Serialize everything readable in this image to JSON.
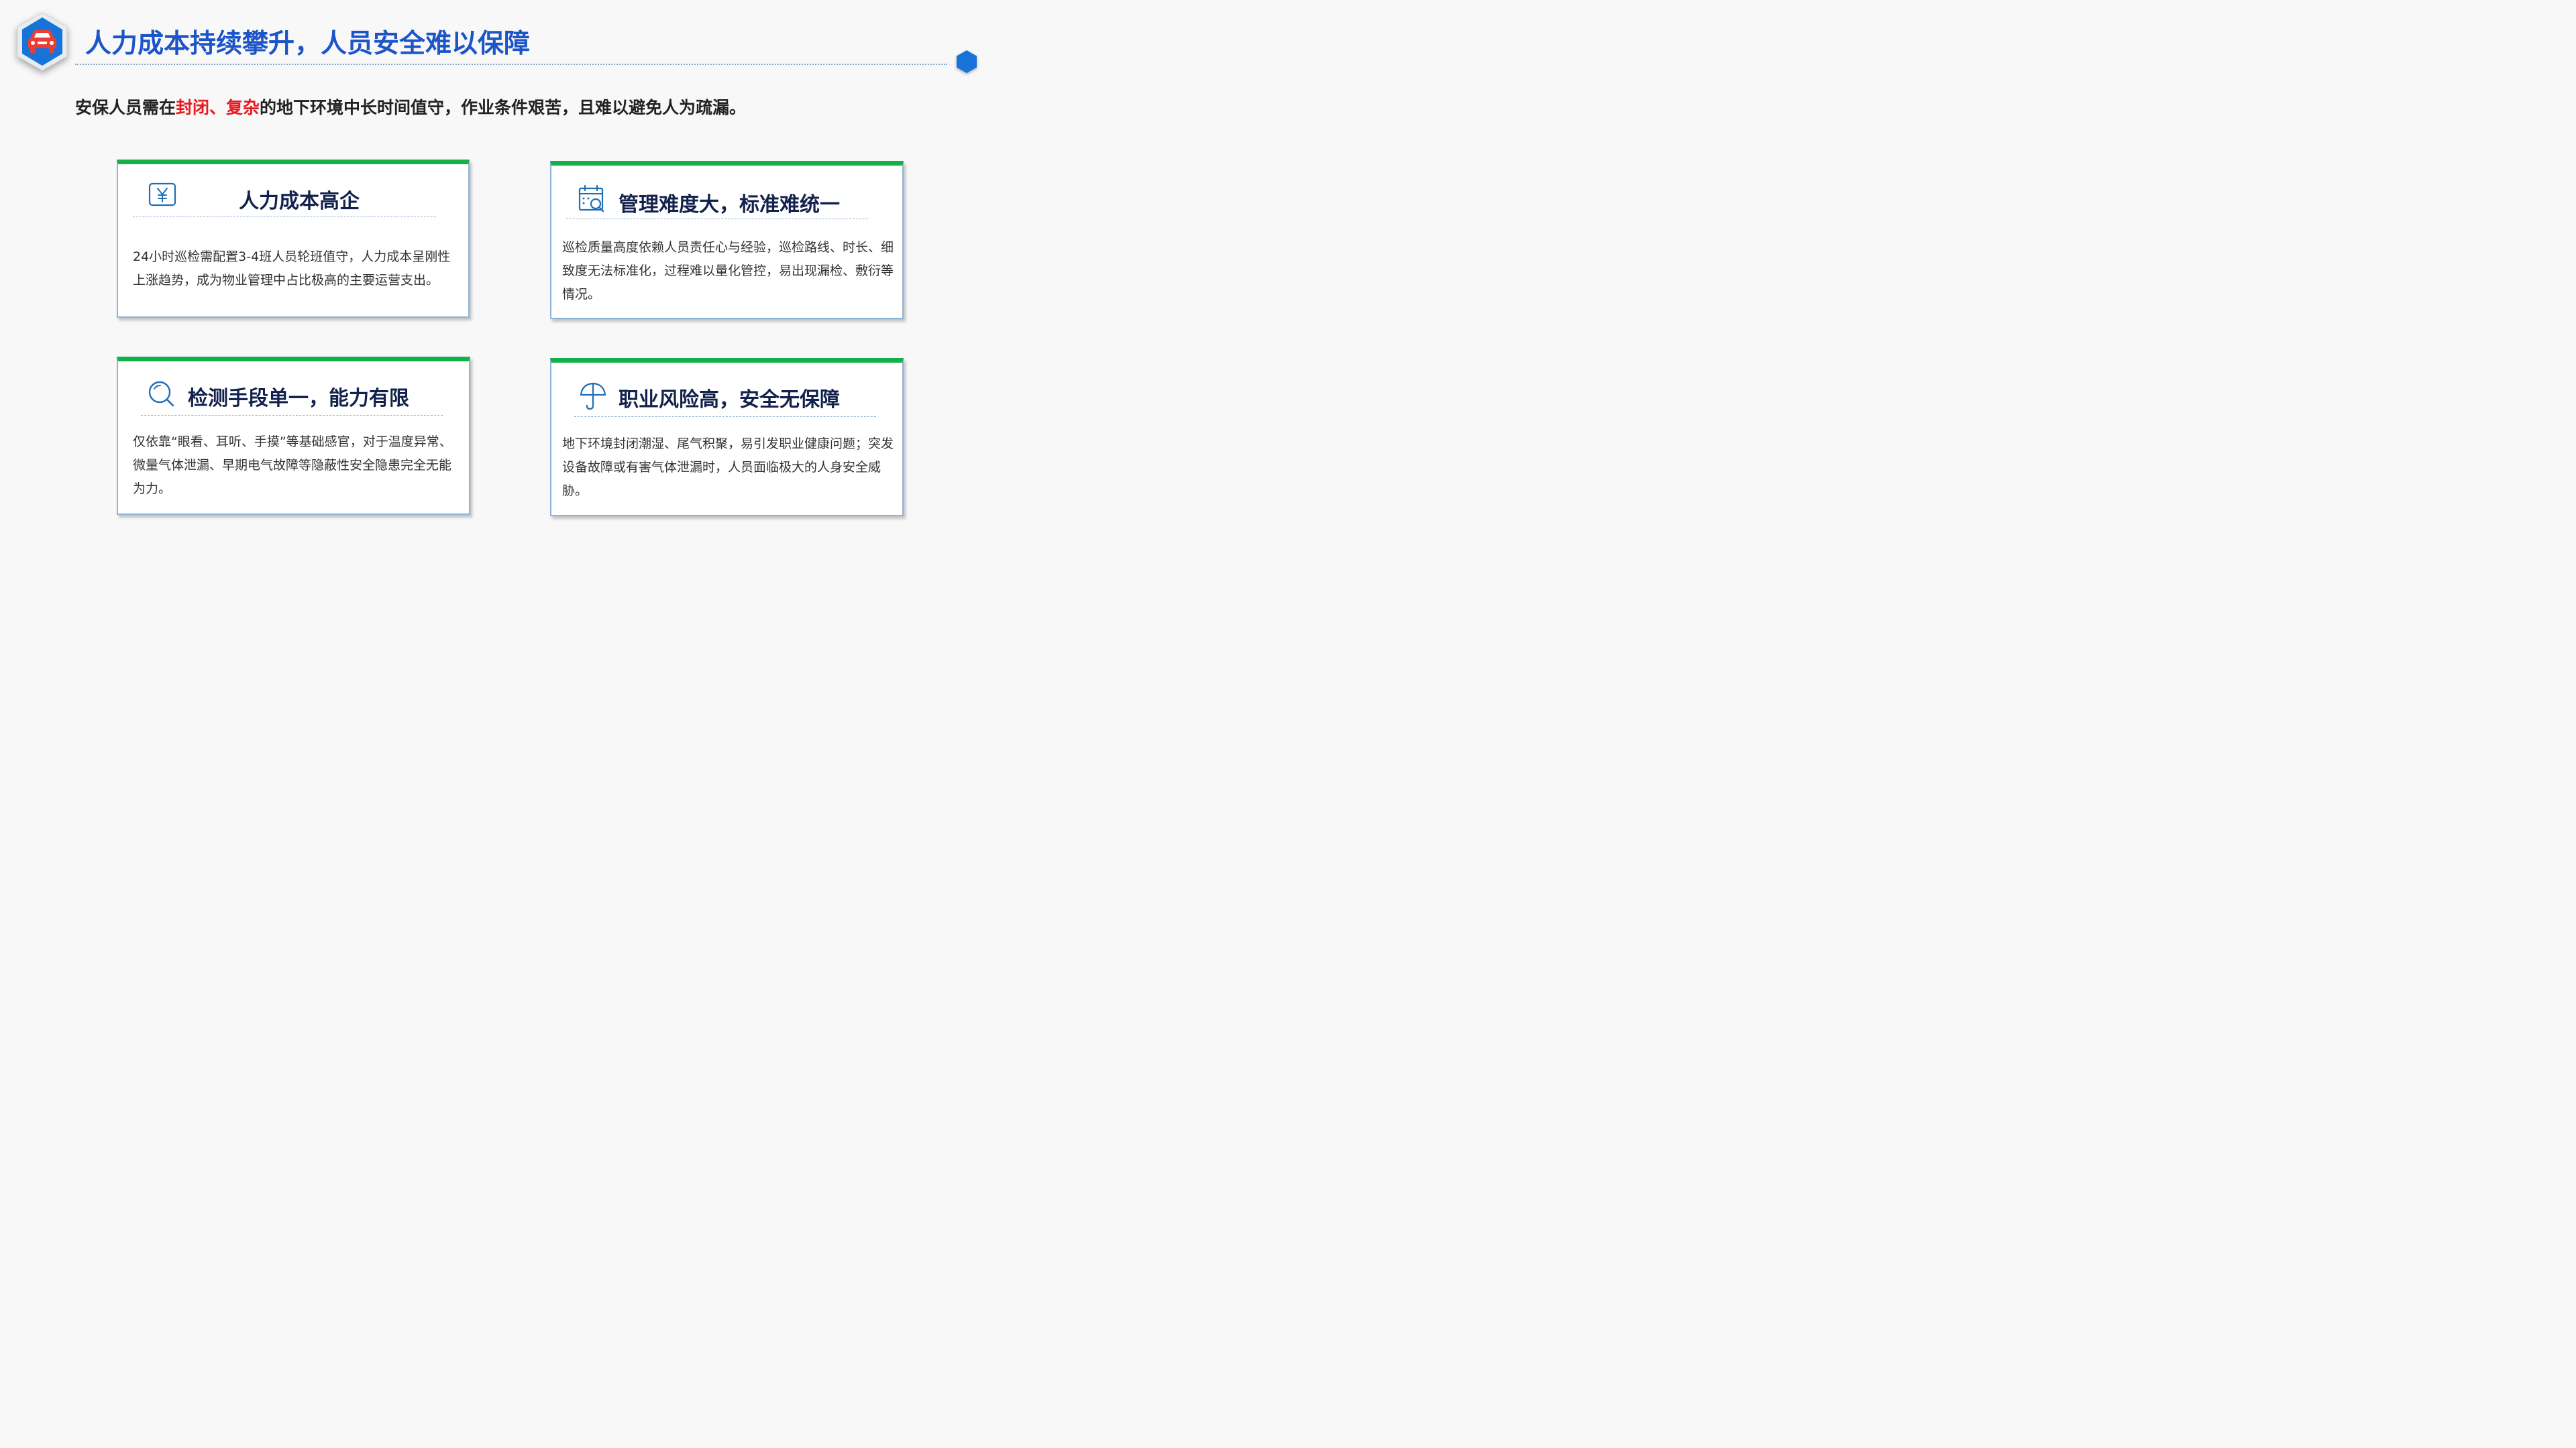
{
  "page": {
    "title": "人力成本持续攀升，人员安全难以保障",
    "subtitle_before": "安保人员需在",
    "subtitle_highlight": "封闭、复杂",
    "subtitle_after": "的地下环境中长时间值守，作业条件艰苦，且难以避免人为疏漏。"
  },
  "logo": {
    "icon": "car-icon"
  },
  "cards": [
    {
      "icon": "yuan-icon",
      "title": "人力成本高企",
      "body": "24小时巡检需配置3-4班人员轮班值守，人力成本呈刚性上涨趋势，成为物业管理中占比极高的主要运营支出。"
    },
    {
      "icon": "calendar-search-icon",
      "title": "管理难度大，标准难统一",
      "body": "巡检质量高度依赖人员责任心与经验，巡检路线、时长、细致度无法标准化，过程难以量化管控，易出现漏检、敷衍等情况。"
    },
    {
      "icon": "search-icon",
      "title": "检测手段单一，能力有限",
      "body": "仅依靠“眼看、耳听、手摸”等基础感官，对于温度异常、微量气体泄漏、早期电气故障等隐蔽性安全隐患完全无能为力。"
    },
    {
      "icon": "umbrella-icon",
      "title": "职业风险高，安全无保障",
      "body": "地下环境封闭潮湿、尾气积聚，易引发职业健康问题；突发设备故障或有害气体泄漏时，人员面临极大的人身安全威胁。"
    }
  ],
  "colors": {
    "title_blue": "#1c55c7",
    "highlight_red": "#e8191e",
    "card_top_green": "#14b04a",
    "card_border": "#8fb3d8",
    "card_title": "#13224d",
    "icon_blue": "#1d6fb8"
  }
}
